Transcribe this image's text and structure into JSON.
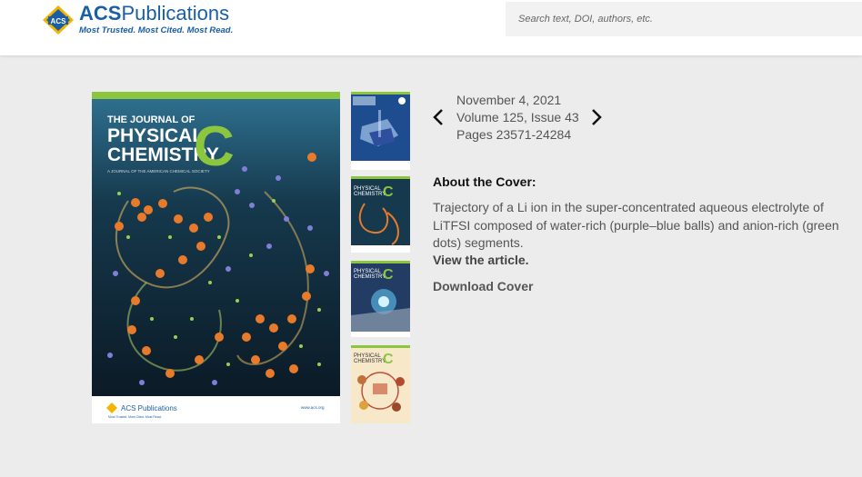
{
  "header": {
    "logo": {
      "name_prefix": "ACS",
      "name_suffix": "Publications",
      "tagline": "Most Trusted. Most Cited. Most Read."
    },
    "search": {
      "placeholder": "Search text, DOI, authors, etc."
    }
  },
  "cover": {
    "journal_line1": "THE JOURNAL OF",
    "journal_line2": "PHYSICAL",
    "journal_line3": "CHEMISTRY",
    "journal_letter": "C",
    "journal_subtitle": "A JOURNAL OF THE AMERICAN CHEMICAL SOCIETY",
    "footer_logo": "ACS Publications",
    "footer_tagline": "Most Trusted. Most Cited. Most Read.",
    "footer_url": "www.acs.org",
    "accent_color": "#8cc63f"
  },
  "issue": {
    "date": "November 4, 2021",
    "volume": "Volume 125, Issue 43",
    "pages": "Pages 23571-24284"
  },
  "about": {
    "title": "About the Cover:",
    "text": "Trajectory of a Li ion in the super-concentrated aqueous electrolyte of LiTFSI composed of water-rich (purple–blue balls) and anion-rich (green dots) segments.",
    "view_link": "View the article.",
    "download": "Download Cover"
  }
}
